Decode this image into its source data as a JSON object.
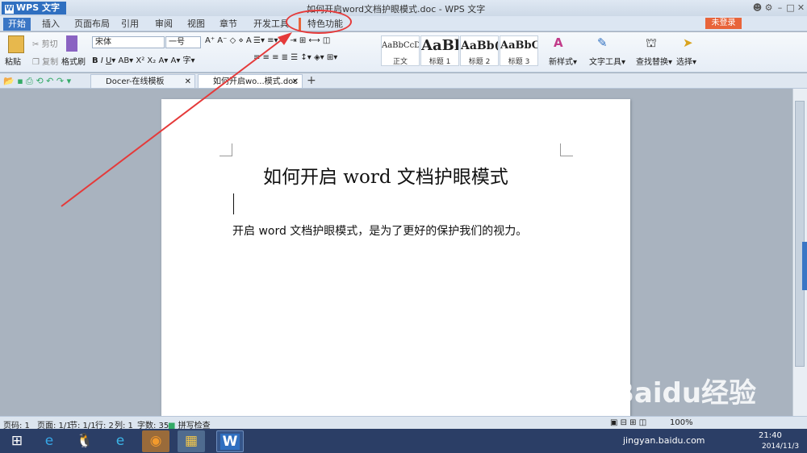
{
  "app": {
    "menu_label": "WPS 文字",
    "title": "如何开启word文档护眼模式.doc - WPS 文字",
    "login_label": "未登录"
  },
  "menu_tabs": [
    "开始",
    "插入",
    "页面布局",
    "引用",
    "审阅",
    "视图",
    "章节",
    "开发工具",
    "特色功能"
  ],
  "ribbon": {
    "paste": "粘贴",
    "cut": "剪切",
    "copy": "复制",
    "format_painter": "格式刷",
    "font_name": "宋体",
    "font_size": "一号",
    "styles": [
      {
        "preview": "AaBbCcDd",
        "label": "正文"
      },
      {
        "preview": "AaBl",
        "label": "标题 1"
      },
      {
        "preview": "AaBb(",
        "label": "标题 2"
      },
      {
        "preview": "AaBbC",
        "label": "标题 3"
      }
    ],
    "new_style": "新样式",
    "text_tools": "文字工具",
    "find_replace": "查找替换",
    "select": "选择"
  },
  "doc_tabs": [
    {
      "label": "Docer-在线模板"
    },
    {
      "label": "如何开启wo...模式.doc"
    }
  ],
  "document": {
    "heading": "如何开启 word 文档护眼模式",
    "body": "开启 word 文档护眼模式，是为了更好的保护我们的视力。"
  },
  "status": {
    "page_code": "页码: 1",
    "pages": "页面: 1/1",
    "section": "节: 1/1",
    "row": "行: 2",
    "col": "列: 1",
    "words": "字数: 35",
    "spell": "拼写检查",
    "zoom": "100%"
  },
  "taskbar": {
    "time": "21:40",
    "date": "2014/11/3"
  },
  "watermark": {
    "brand": "Baidu经验",
    "url": "jingyan.baidu.com"
  },
  "colors": {
    "accent": "#3a76c5",
    "annotation": "#e53a3a",
    "login": "#e8643a"
  }
}
